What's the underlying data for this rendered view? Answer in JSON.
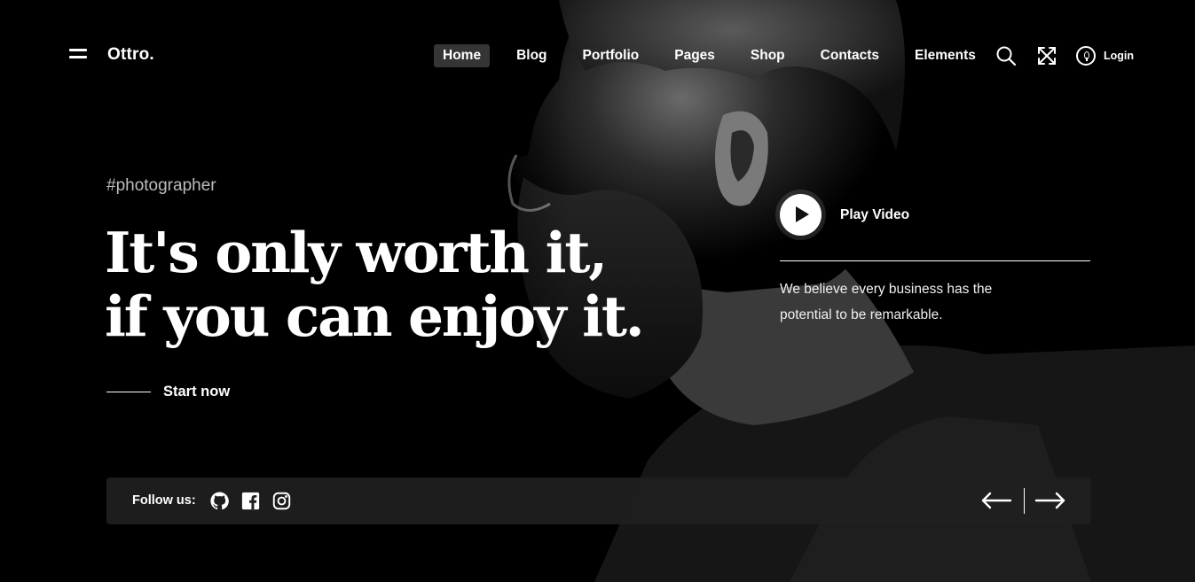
{
  "brand": {
    "name": "Ottro."
  },
  "nav": {
    "items": [
      {
        "label": "Home",
        "active": true
      },
      {
        "label": "Blog",
        "active": false
      },
      {
        "label": "Portfolio",
        "active": false
      },
      {
        "label": "Pages",
        "active": false
      },
      {
        "label": "Shop",
        "active": false
      },
      {
        "label": "Contacts",
        "active": false
      },
      {
        "label": "Elements",
        "active": false
      }
    ],
    "login_label": "Login",
    "icons": [
      "search-icon",
      "fullscreen-icon",
      "login-icon"
    ]
  },
  "hero": {
    "tagline": "#photographer",
    "headline_line1": "It's only worth it,",
    "headline_line2": "if you can enjoy it.",
    "cta_label": "Start now",
    "play_label": "Play Video",
    "description": "We believe every business has the potential to be remarkable."
  },
  "footer_bar": {
    "follow_label": "Follow us:",
    "social_icons": [
      "github-icon",
      "facebook-icon",
      "instagram-icon"
    ],
    "nav_icons": [
      "arrow-left-icon",
      "arrow-right-icon"
    ]
  },
  "colors": {
    "background": "#000000",
    "text": "#ffffff",
    "active_nav_bg": "#353535",
    "bottom_bar_bg": "#202020",
    "tagline": "#bdbdbd"
  }
}
